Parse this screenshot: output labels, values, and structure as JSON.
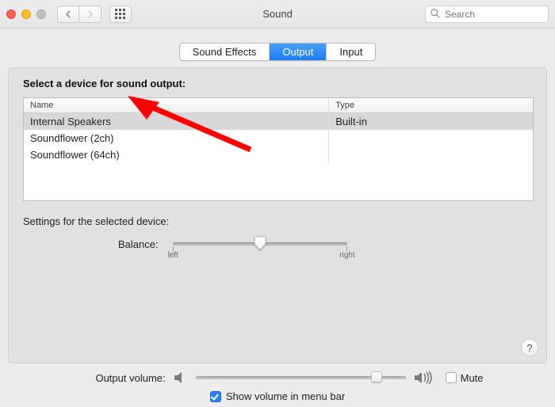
{
  "window": {
    "title": "Sound"
  },
  "search": {
    "placeholder": "Search"
  },
  "tabs": {
    "effects": "Sound Effects",
    "output": "Output",
    "input": "Input",
    "selected": "Output"
  },
  "panel": {
    "heading": "Select a device for sound output:",
    "cols": {
      "name": "Name",
      "type": "Type"
    },
    "devices": [
      {
        "name": "Internal Speakers",
        "type": "Built-in",
        "selected": true
      },
      {
        "name": "Soundflower (2ch)",
        "type": "",
        "selected": false
      },
      {
        "name": "Soundflower (64ch)",
        "type": "",
        "selected": false
      }
    ],
    "settingsText": "Settings for the selected device:",
    "balance": {
      "label": "Balance:",
      "left": "left",
      "right": "right",
      "value": 0.5
    },
    "help": "?"
  },
  "volume": {
    "label": "Output volume:",
    "value": 0.86,
    "mute": {
      "label": "Mute",
      "checked": false
    }
  },
  "menuBar": {
    "label": "Show volume in menu bar",
    "checked": true
  }
}
